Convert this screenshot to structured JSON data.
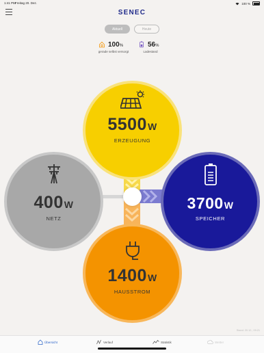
{
  "status_bar": {
    "time": "1:41 PM",
    "date": "Freitag 20. Dez.",
    "battery": "100 %"
  },
  "header": {
    "logo": "SENEC"
  },
  "toggle": {
    "active_label": "Aktuell",
    "inactive_label": "Heute"
  },
  "stats": [
    {
      "value": "100",
      "unit": "%",
      "label": "gerade selbst versorgt",
      "icon": "home-sun-icon",
      "color": "#f49300"
    },
    {
      "value": "56",
      "unit": "%",
      "label": "Ladestand",
      "icon": "battery-icon",
      "color": "#7a5cc4"
    }
  ],
  "flows": {
    "generation": {
      "value": "5500",
      "unit": "W",
      "label": "ERZEUGUNG",
      "icon": "solar-panel-icon",
      "color": "#f7cf00"
    },
    "grid": {
      "value": "400",
      "unit": "W",
      "label": "NETZ",
      "icon": "power-pylon-icon",
      "color": "#a8a8a8"
    },
    "storage": {
      "value": "3700",
      "unit": "W",
      "label": "SPEICHER",
      "icon": "battery-storage-icon",
      "color": "#19199a"
    },
    "house": {
      "value": "1400",
      "unit": "W",
      "label": "HAUSSTROM",
      "icon": "plug-icon",
      "color": "#f49300"
    }
  },
  "footer_note": "Stand: 20.12., 09:21",
  "tabs": [
    {
      "label": "Übersicht",
      "icon": "home-icon",
      "state": "active"
    },
    {
      "label": "Verlauf",
      "icon": "chart-icon",
      "state": "normal"
    },
    {
      "label": "Statistik",
      "icon": "statistics-icon",
      "state": "normal"
    },
    {
      "label": "Wetter",
      "icon": "weather-icon",
      "state": "disabled"
    }
  ]
}
